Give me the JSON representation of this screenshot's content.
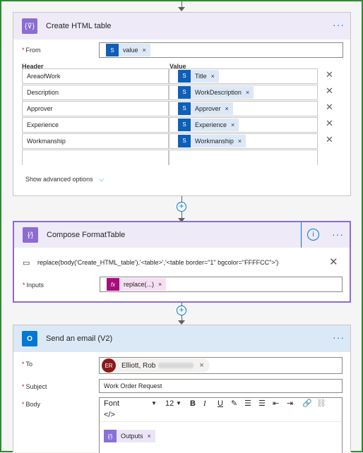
{
  "create_table": {
    "title": "Create HTML table",
    "from_label": "From",
    "from_token": "value",
    "header_col": "Header",
    "value_col": "Value",
    "rows": [
      {
        "header": "AreaofWork",
        "value": "Title"
      },
      {
        "header": "Description",
        "value": "WorkDescription"
      },
      {
        "header": "Approver",
        "value": "Approver"
      },
      {
        "header": "Experience",
        "value": "Experience"
      },
      {
        "header": "Workmanship",
        "value": "Workmanship"
      }
    ],
    "advanced": "Show advanced options"
  },
  "compose": {
    "title": "Compose FormatTable",
    "expression": "replace(body('Create_HTML_table'),'<table>','<table border=\"1\" bgcolor=\"FFFFCC\">')",
    "inputs_label": "Inputs",
    "inputs_token": "replace(...)"
  },
  "email": {
    "title": "Send an email (V2)",
    "to_label": "To",
    "to_initials": "ER",
    "to_name": "Elliott, Rob",
    "subject_label": "Subject",
    "subject_value": "Work Order Request",
    "body_label": "Body",
    "font": "Font",
    "font_size": "12",
    "code_view": "</>",
    "outputs_token": "Outputs"
  },
  "colors": {
    "create_table_accent": "#8c6cd1",
    "compose_accent": "#8c6cd1",
    "email_accent": "#0078d4",
    "frame_border": "#2e8b2e"
  }
}
